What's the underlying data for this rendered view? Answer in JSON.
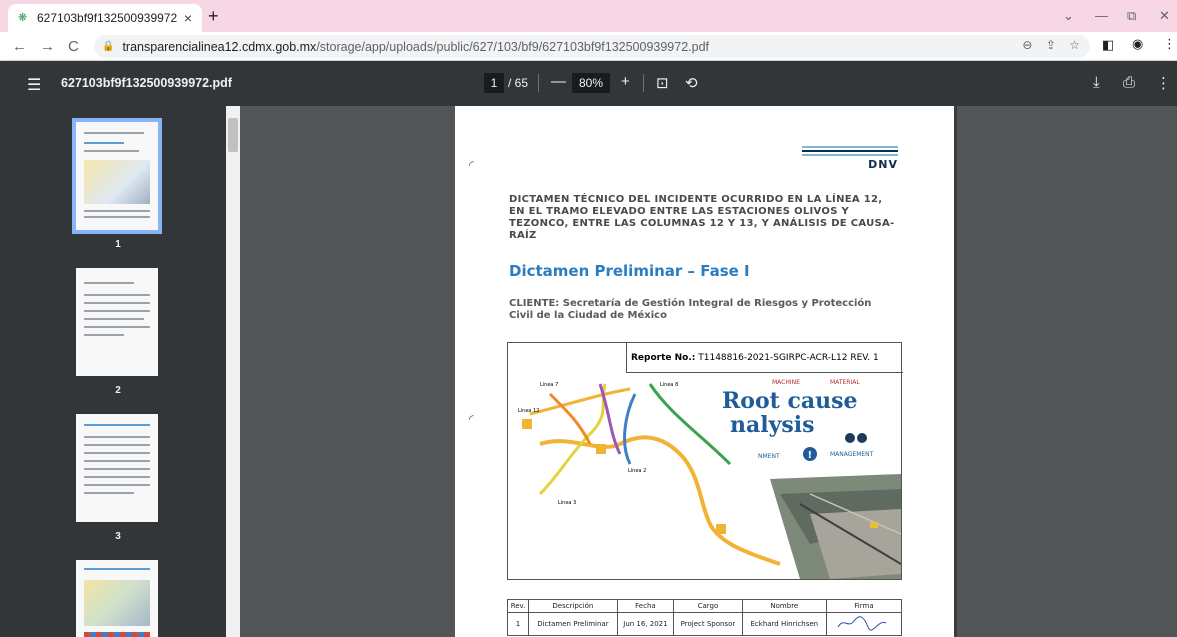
{
  "browser": {
    "tab_title": "627103bf9f132500939972.pdf",
    "tab_close": "×",
    "new_tab": "+",
    "win_minimize": "—",
    "win_restore": "⧉",
    "win_close": "✕",
    "tabs_dropdown": "⌄",
    "url_host": "transparencialinea12.cdmx.gob.mx",
    "url_path": "/storage/app/uploads/public/627/103/bf9/627103bf9f132500939972.pdf"
  },
  "pdf_toolbar": {
    "doc_name": "627103bf9f132500939972.pdf",
    "current_page": "1",
    "total_pages": "/ 65",
    "zoom": "80%",
    "zoom_out": "—",
    "zoom_in": "+"
  },
  "thumbnails": [
    {
      "number": "1",
      "active": true
    },
    {
      "number": "2",
      "active": false
    },
    {
      "number": "3",
      "active": false
    }
  ],
  "document": {
    "logo": "DNV",
    "title": "DICTAMEN TÉCNICO DEL INCIDENTE OCURRIDO EN LA LÍNEA 12, EN EL TRAMO ELEVADO ENTRE LAS ESTACIONES OLIVOS Y TEZONCO, ENTRE LAS COLUMNAS 12 Y 13, Y ANÁLISIS DE CAUSA-RAÍZ",
    "subtitle": "Dictamen Preliminar – Fase I",
    "client": "CLIENTE: Secretaría de Gestión Integral de Riesgos y Protección Civil de la Ciudad de México",
    "report_label": "Reporte No.:",
    "report_number": "T1148816-2021-SGIRPC-ACR-L12 REV. 1",
    "figure": {
      "map_labels": [
        "Línea 7",
        "Línea 8",
        "Línea 12",
        "Línea 2",
        "Línea 3"
      ],
      "rca_title_1": "Root cause",
      "rca_title_2": "nalysis",
      "rca_words": [
        "MACHINE",
        "MATERIAL",
        "MANAGEMENT",
        "NMENT"
      ]
    },
    "revision_table": {
      "headers": [
        "Rev.",
        "Descripción",
        "Fecha",
        "Cargo",
        "Nombre",
        "Firma"
      ],
      "rows": [
        [
          "1",
          "Dictamen Preliminar",
          "Jun 16, 2021",
          "Project Sponsor",
          "Eckhard Hinrichsen",
          ""
        ]
      ]
    }
  }
}
